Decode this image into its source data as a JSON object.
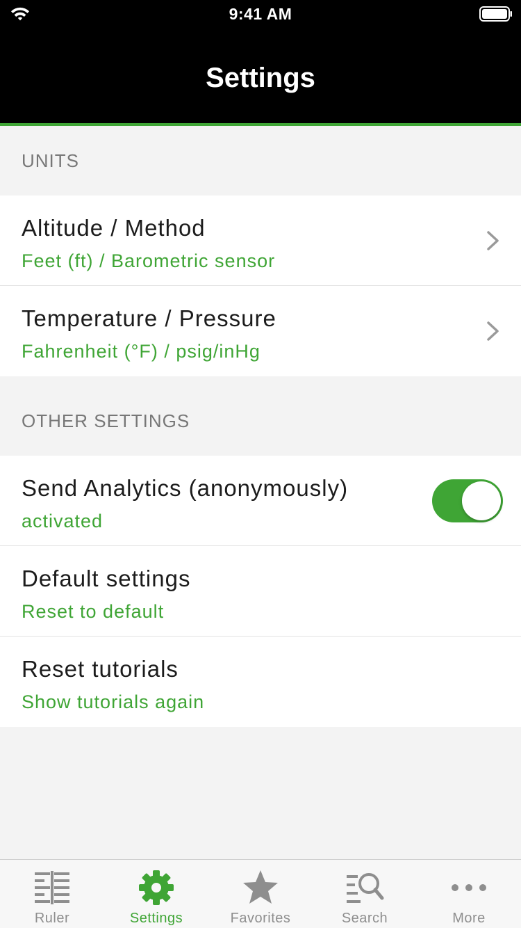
{
  "status_bar": {
    "time": "9:41 AM"
  },
  "nav": {
    "title": "Settings"
  },
  "colors": {
    "accent": "#3fa535",
    "header_bg": "#000000",
    "section_bg": "#f3f3f3"
  },
  "sections": [
    {
      "header": "UNITS",
      "rows": [
        {
          "title": "Altitude / Method",
          "subtitle": "Feet (ft) / Barometric sensor",
          "accessory": "chevron-right-icon"
        },
        {
          "title": "Temperature / Pressure",
          "subtitle": "Fahrenheit (°F) / psig/inHg",
          "accessory": "chevron-right-icon"
        }
      ]
    },
    {
      "header": "OTHER SETTINGS",
      "rows": [
        {
          "title": "Send Analytics (anonymously)",
          "subtitle": "activated",
          "accessory": "toggle",
          "toggle_on": true
        },
        {
          "title": "Default settings",
          "subtitle": "Reset to default"
        },
        {
          "title": "Reset tutorials",
          "subtitle": "Show tutorials again"
        }
      ]
    }
  ],
  "tabs": [
    {
      "label": "Ruler",
      "icon": "ruler-icon",
      "active": false
    },
    {
      "label": "Settings",
      "icon": "gear-icon",
      "active": true
    },
    {
      "label": "Favorites",
      "icon": "star-icon",
      "active": false
    },
    {
      "label": "Search",
      "icon": "search-icon",
      "active": false
    },
    {
      "label": "More",
      "icon": "more-icon",
      "active": false
    }
  ]
}
